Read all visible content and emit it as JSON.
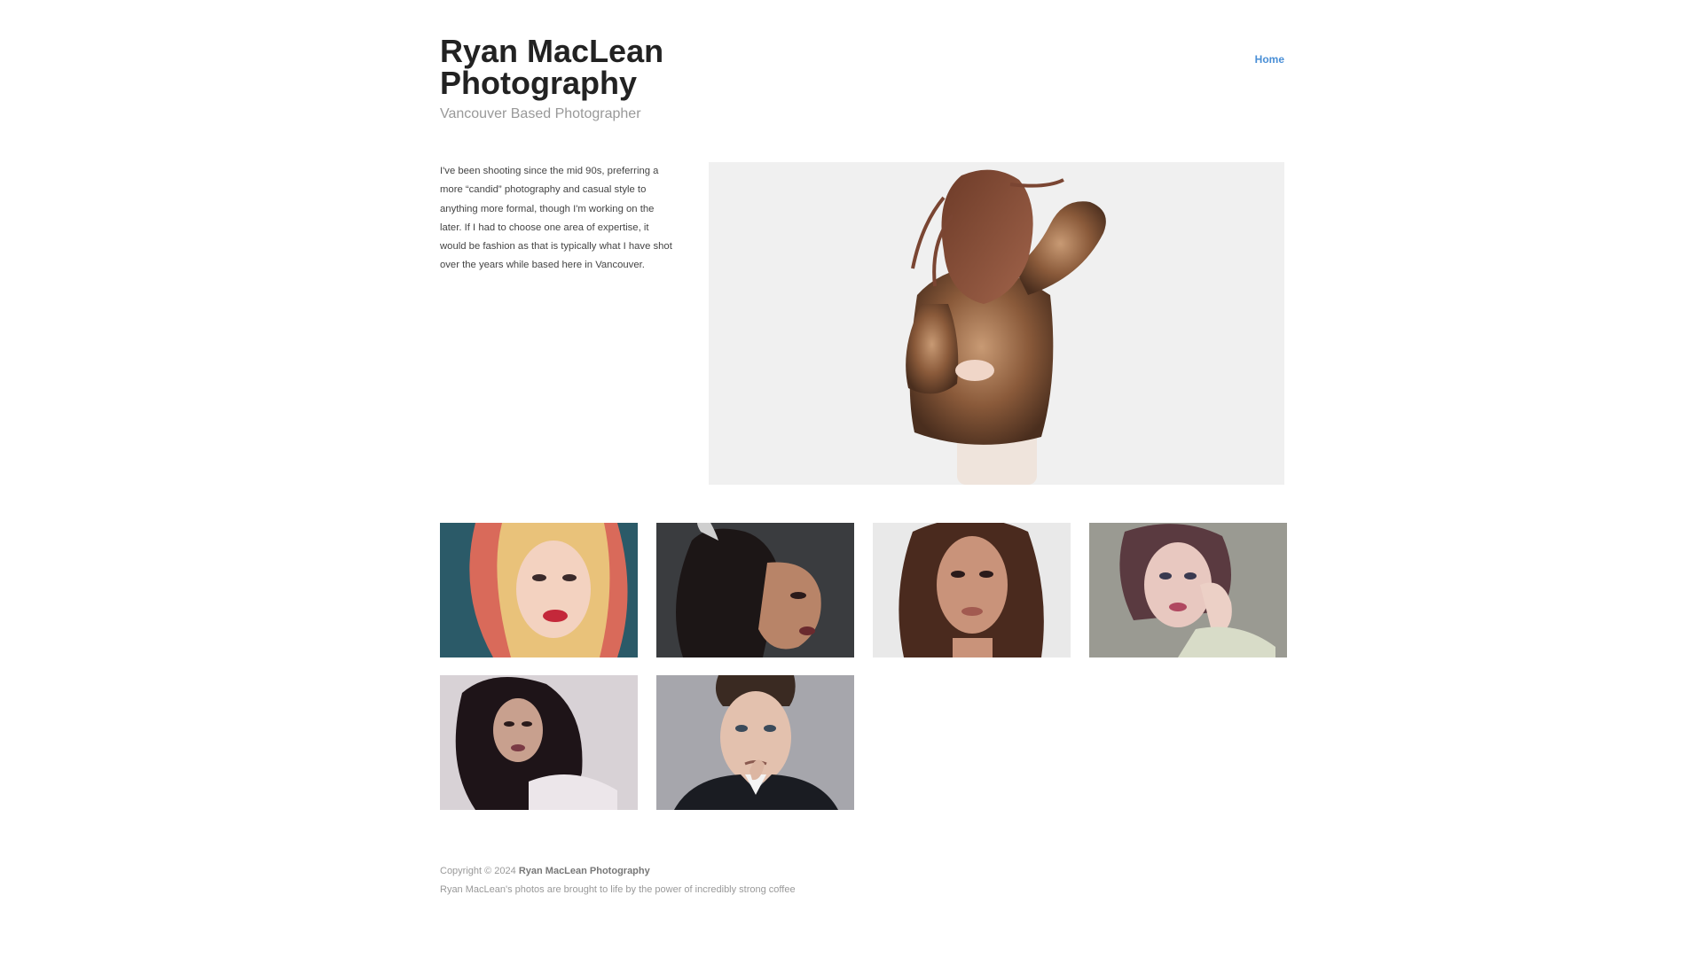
{
  "header": {
    "title": "Ryan MacLean Photography",
    "tagline": "Vancouver Based Photographer"
  },
  "nav": {
    "items": [
      {
        "label": "Home"
      }
    ],
    "link_color": "#4a8fd6"
  },
  "intro": {
    "text": "I've been shooting since the mid 90s, preferring a more “candid” photography and casual style to anything more formal, though I'm working on the later. If I had to choose one area of expertise, it would be fashion as that is typically what I have shot over the years while based here in Vancouver."
  },
  "hero": {
    "subject": "woman-in-fur-coat-photo"
  },
  "gallery": {
    "items": [
      {
        "subject": "woman-red-scarf-portrait"
      },
      {
        "subject": "woman-ponytail-profile-portrait"
      },
      {
        "subject": "woman-long-brown-hair-portrait"
      },
      {
        "subject": "woman-hand-on-face-portrait"
      },
      {
        "subject": "woman-curly-hair-portrait"
      },
      {
        "subject": "man-in-suit-portrait"
      }
    ]
  },
  "footer": {
    "copyright_prefix": "Copyright © 2024",
    "brand": "Ryan MacLean Photography",
    "line2": "Ryan MacLean's photos are brought to life by the power of incredibly strong coffee"
  }
}
